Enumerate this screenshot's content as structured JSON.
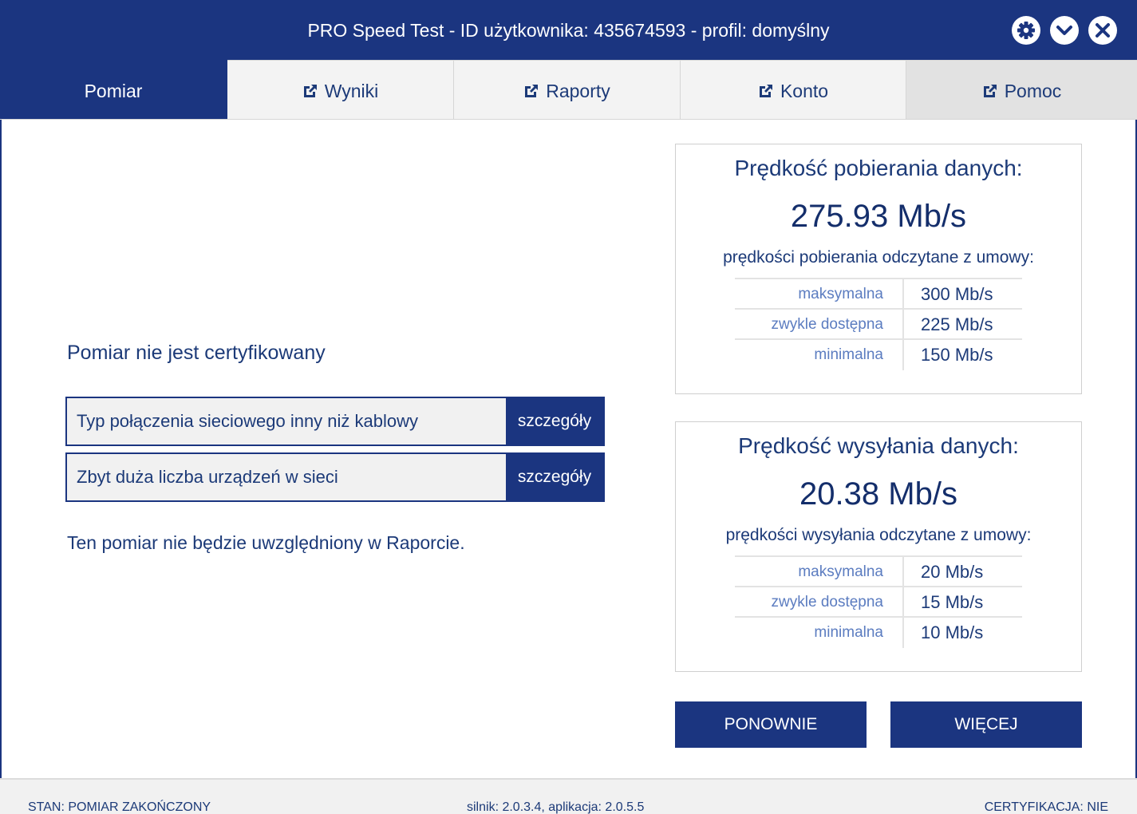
{
  "window": {
    "title": "PRO Speed Test - ID użytkownika: 435674593 - profil: domyślny",
    "buttons": {
      "settings_icon": "gear-icon",
      "minimize_icon": "chevron-down-icon",
      "close_icon": "close-icon"
    }
  },
  "tabs": [
    {
      "label": "Pomiar",
      "active": true,
      "external": false
    },
    {
      "label": "Wyniki",
      "active": false,
      "external": true
    },
    {
      "label": "Raporty",
      "active": false,
      "external": true
    },
    {
      "label": "Konto",
      "active": false,
      "external": true
    },
    {
      "label": "Pomoc",
      "active": false,
      "external": true
    }
  ],
  "certification": {
    "heading": "Pomiar nie jest certyfikowany",
    "issues": [
      {
        "text": "Typ połączenia sieciowego inny niż kablowy",
        "button": "szczegóły"
      },
      {
        "text": "Zbyt duża liczba urządzeń w sieci",
        "button": "szczegóły"
      }
    ],
    "note": "Ten pomiar nie będzie uwzględniony w Raporcie."
  },
  "download": {
    "title": "Prędkość pobierania danych:",
    "value": "275.93 Mb/s",
    "subtitle": "prędkości pobierania odczytane z umowy:",
    "rows": [
      {
        "label": "maksymalna",
        "value": "300 Mb/s"
      },
      {
        "label": "zwykle dostępna",
        "value": "225 Mb/s"
      },
      {
        "label": "minimalna",
        "value": "150 Mb/s"
      }
    ]
  },
  "upload": {
    "title": "Prędkość wysyłania danych:",
    "value": "20.38 Mb/s",
    "subtitle": "prędkości wysyłania odczytane z umowy:",
    "rows": [
      {
        "label": "maksymalna",
        "value": "20 Mb/s"
      },
      {
        "label": "zwykle dostępna",
        "value": "15 Mb/s"
      },
      {
        "label": "minimalna",
        "value": "10 Mb/s"
      }
    ]
  },
  "actions": {
    "again": "PONOWNIE",
    "more": "WIĘCEJ"
  },
  "status": {
    "state": "STAN: POMIAR ZAKOŃCZONY",
    "version": "silnik: 2.0.3.4, aplikacja: 2.0.5.5",
    "certification": "CERTYFIKACJA: NIE"
  },
  "colors": {
    "brand": "#1b3580",
    "text": "#1c3a78",
    "muted_label": "#5b7cc0",
    "tab_bg": "#f3f3f3",
    "tab_hover_bg": "#e2e2e2"
  }
}
